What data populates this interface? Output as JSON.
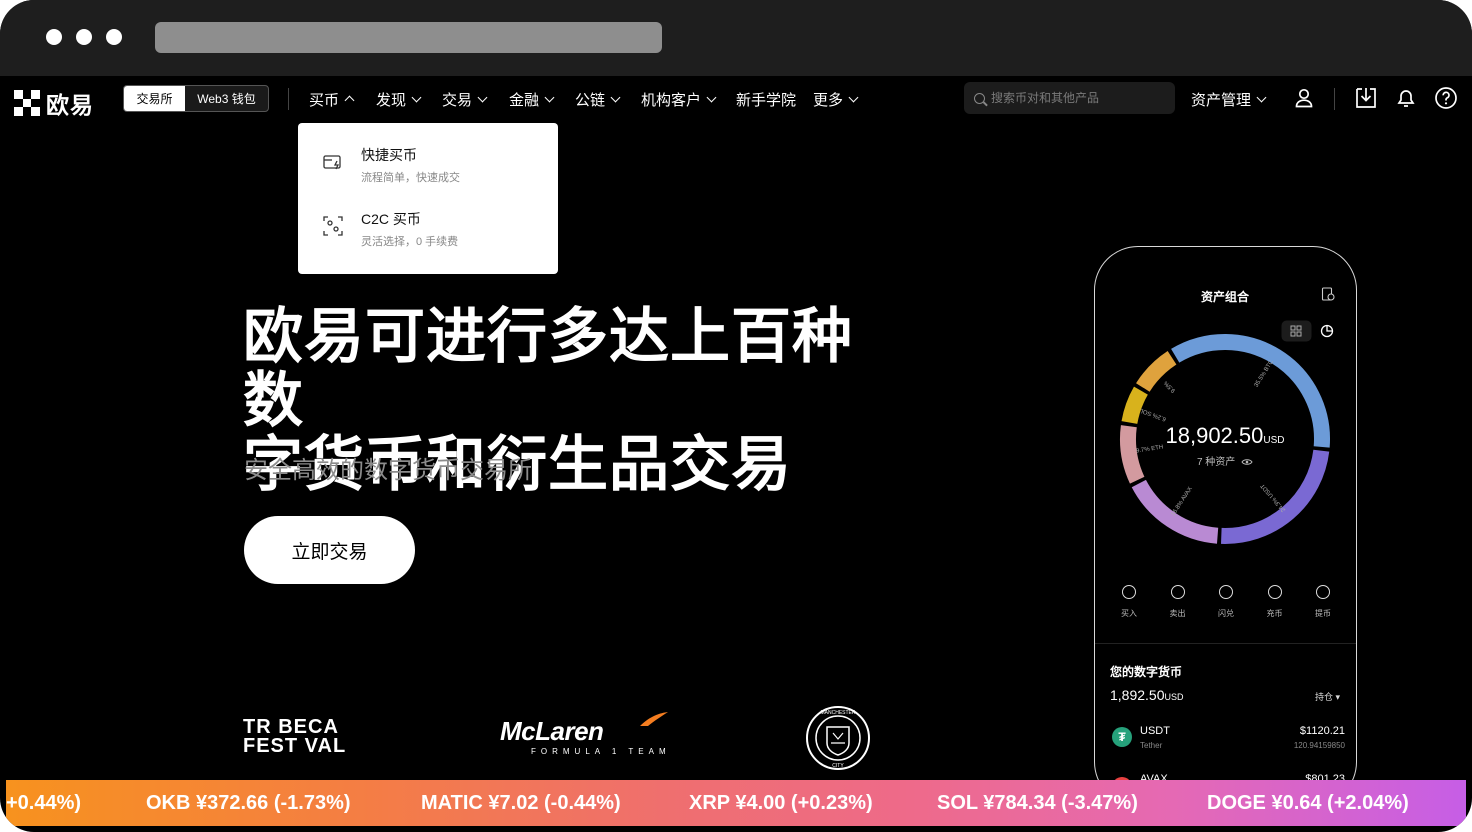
{
  "browser": {
    "dots": 3
  },
  "nav": {
    "brand": "欧易",
    "segment": {
      "exchange": "交易所",
      "web3": "Web3 钱包"
    },
    "menu": [
      {
        "label": "买币",
        "open": true
      },
      {
        "label": "发现"
      },
      {
        "label": "交易"
      },
      {
        "label": "金融"
      },
      {
        "label": "公链"
      },
      {
        "label": "机构客户"
      },
      {
        "label": "新手学院"
      },
      {
        "label": "更多"
      }
    ],
    "search_placeholder": "搜索币对和其他产品",
    "asset_menu": "资产管理",
    "icons": [
      "user-icon",
      "download-icon",
      "bell-icon",
      "help-icon"
    ]
  },
  "dropdown": {
    "items": [
      {
        "title": "快捷买币",
        "subtitle": "流程简单，快速成交",
        "icon": "quick-buy-icon"
      },
      {
        "title": "C2C 买币",
        "subtitle": "灵活选择，0 手续费",
        "icon": "c2c-icon"
      }
    ]
  },
  "hero": {
    "title_line1": "欧易可进行多达上百种数",
    "title_line2": "字货币和衍生品交易",
    "subtitle": "安全高效的数字货币交易所",
    "cta": "立即交易"
  },
  "sponsors": {
    "tribeca_line1": "TR BECA",
    "tribeca_line2": "FEST VAL",
    "mclaren": "McLaren",
    "mclaren_sub": "FORMULA 1 TEAM",
    "mancity_top": "MANCHESTER",
    "mancity_bottom": "CITY"
  },
  "phone": {
    "title": "资产组合",
    "total": "18,902.50",
    "total_unit": "USD",
    "asset_count": "7 种资产",
    "donut": [
      {
        "label": "35.5% BTC",
        "value": 35.5,
        "color": "#6c9bd8"
      },
      {
        "label": "24.3% USDT",
        "value": 24.3,
        "color": "#7a69d3"
      },
      {
        "label": "16.8% AVAX",
        "value": 16.8,
        "color": "#b98ad3"
      },
      {
        "label": "9.7% ETH",
        "value": 9.7,
        "color": "#d39a9f"
      },
      {
        "label": "6.2% SOL",
        "value": 6.2,
        "color": "#d8b21c"
      },
      {
        "label": "9.5%",
        "value": 7.5,
        "color": "#dfa23d"
      }
    ],
    "actions": [
      "买入",
      "卖出",
      "闪兑",
      "充币",
      "提币"
    ],
    "section_title": "您的数字货币",
    "balance": "1,892.50",
    "balance_unit": "USD",
    "hold_label": "持仓",
    "coins": [
      {
        "symbol": "USDT",
        "name": "Tether",
        "value": "$1120.21",
        "amount": "120.94159850"
      },
      {
        "symbol": "AVAX",
        "name": "",
        "value": "$801.23",
        "amount": ""
      }
    ]
  },
  "ticker": [
    "+0.44%)",
    "OKB ¥372.66 (-1.73%)",
    "MATIC ¥7.02 (-0.44%)",
    "XRP ¥4.00 (+0.23%)",
    "SOL ¥784.34 (-3.47%)",
    "DOGE ¥0.64 (+2.04%)"
  ]
}
